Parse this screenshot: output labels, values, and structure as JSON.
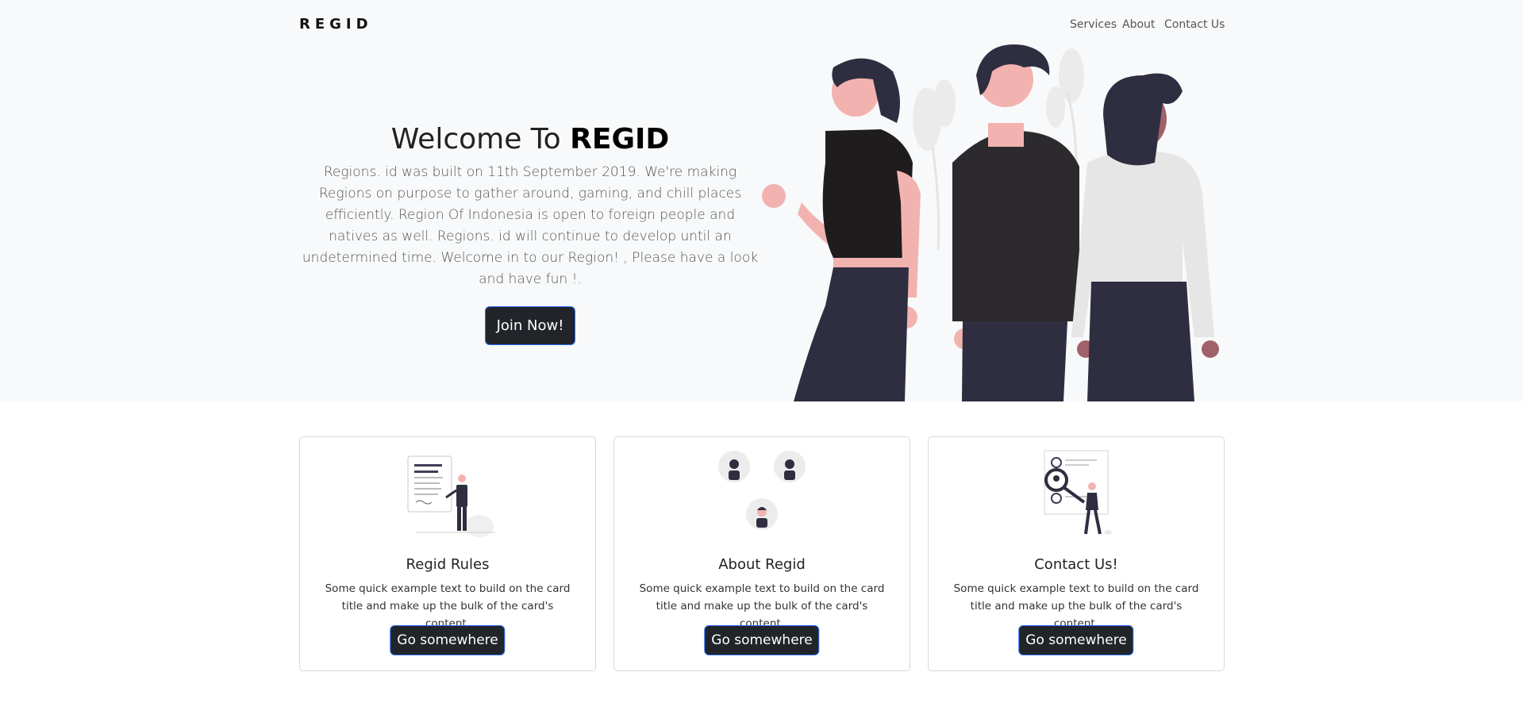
{
  "navbar": {
    "brand": "REGID",
    "links": [
      "Services",
      "About",
      "Contact Us"
    ]
  },
  "hero": {
    "title_prefix": "Welcome To ",
    "title_bold": "REGID",
    "description": "Regions. id was built on 11th September 2019. We're making Regions on purpose to gather around, gaming, and chill places efficiently. Region Of Indonesia is open to foreign people and natives as well. Regions. id will continue to develop until an undetermined time. Welcome in to our Region! , Please have a look and have fun !.",
    "button": "Join Now!"
  },
  "cards": [
    {
      "title": "Regid Rules",
      "text": "Some quick example text to build on the card title and make up the bulk of the card's content.",
      "button": "Go somewhere",
      "illustration": "person-with-document"
    },
    {
      "title": "About Regid",
      "text": "Some quick example text to build on the card title and make up the bulk of the card's content.",
      "button": "Go somewhere",
      "illustration": "team-avatars"
    },
    {
      "title": "Contact Us!",
      "text": "Some quick example text to build on the card title and make up the bulk of the card's content.",
      "button": "Go somewhere",
      "illustration": "person-with-magnifier"
    }
  ],
  "colors": {
    "hero_bg": "#f8f9fa",
    "button_bg": "#212529",
    "button_border": "#2b6cff"
  }
}
